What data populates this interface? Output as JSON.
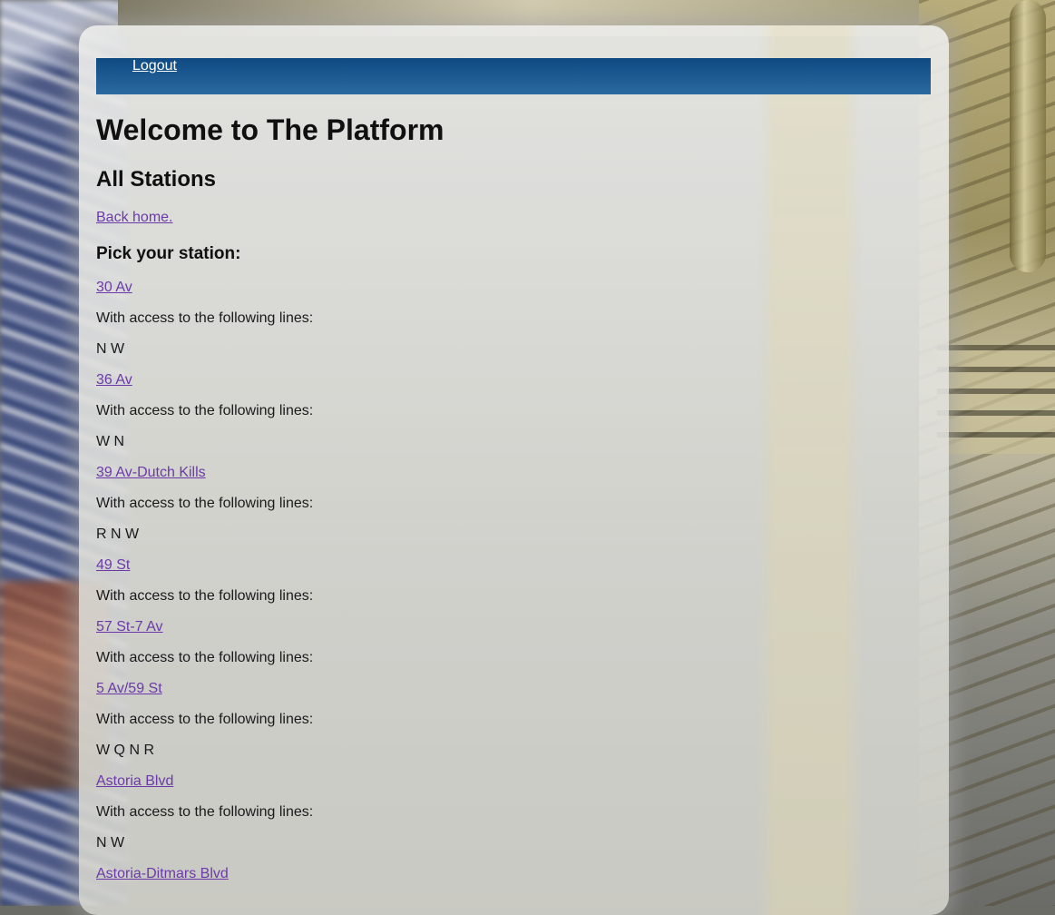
{
  "nav": {
    "logout": "Logout"
  },
  "page": {
    "title": "Welcome to The Platform",
    "subtitle": "All Stations",
    "back_link": "Back home.",
    "pick_label": "Pick your station:"
  },
  "stations": [
    {
      "name": "30 Av",
      "access": "With access to the following lines:",
      "lines": "N W"
    },
    {
      "name": "36 Av",
      "access": "With access to the following lines:",
      "lines": "W N"
    },
    {
      "name": "39 Av-Dutch Kills",
      "access": "With access to the following lines:",
      "lines": "R N W"
    },
    {
      "name": "49 St",
      "access": "With access to the following lines:",
      "lines": ""
    },
    {
      "name": "57 St-7 Av",
      "access": "With access to the following lines:",
      "lines": ""
    },
    {
      "name": "5 Av/59 St",
      "access": "With access to the following lines:",
      "lines": "W Q N R"
    },
    {
      "name": "Astoria Blvd",
      "access": "With access to the following lines:",
      "lines": "N W"
    },
    {
      "name": "Astoria-Ditmars Blvd",
      "access": "",
      "lines": ""
    }
  ]
}
